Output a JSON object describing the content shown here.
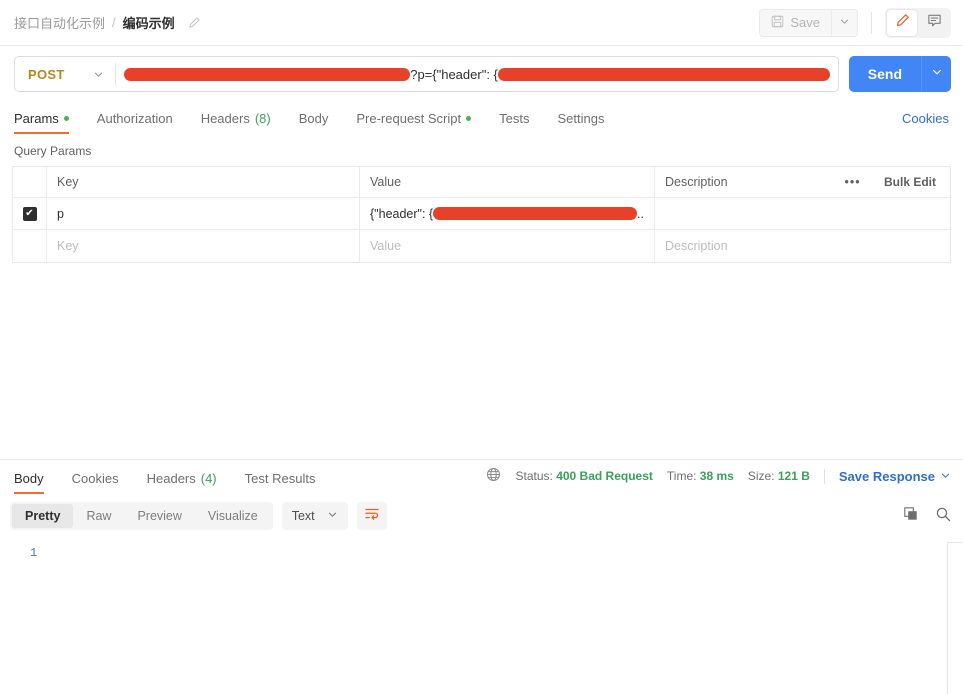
{
  "topbar": {
    "breadcrumb_collection": "接口自动化示例",
    "breadcrumb_separator": "/",
    "breadcrumb_current": "编码示例",
    "edit_icon": "pencil-icon",
    "save_label": "Save",
    "save_icon": "floppy-disk-icon",
    "save_caret_icon": "chevron-down-icon",
    "edit_toggle_icon": "pencil-icon",
    "comment_toggle_icon": "comment-icon",
    "accent_orange": "#ef5b25"
  },
  "url_row": {
    "method": "POST",
    "method_caret_icon": "chevron-down-icon",
    "method_color": "#b58a1b",
    "url_prefix_redacted_width": 326,
    "url_visible_text": "?p={\"header\": {",
    "url_suffix_redacted_width": 378,
    "redaction_color": "#e8412a",
    "send_label": "Send",
    "send_caret_icon": "chevron-down-icon",
    "send_color": "#4285f4"
  },
  "request_tabs": {
    "items": [
      {
        "label": "Params",
        "dot": true,
        "count": "",
        "active": true
      },
      {
        "label": "Authorization",
        "dot": false,
        "count": "",
        "active": false
      },
      {
        "label": "Headers",
        "dot": false,
        "count": "(8)",
        "active": false
      },
      {
        "label": "Body",
        "dot": false,
        "count": "",
        "active": false
      },
      {
        "label": "Pre-request Script",
        "dot": true,
        "count": "",
        "active": false
      },
      {
        "label": "Tests",
        "dot": false,
        "count": "",
        "active": false
      },
      {
        "label": "Settings",
        "dot": false,
        "count": "",
        "active": false
      }
    ],
    "cookies_label": "Cookies"
  },
  "query_params": {
    "title": "Query Params",
    "headers": {
      "key": "Key",
      "value": "Value",
      "description": "Description",
      "options_icon": "ellipsis-icon",
      "bulk_edit": "Bulk Edit"
    },
    "rows": [
      {
        "checked": true,
        "check_glyph": "✔",
        "key": "p",
        "value_prefix": "{\"header\": {",
        "value_redacted_width": 205,
        "value_suffix": "..",
        "description": ""
      }
    ],
    "empty_row": {
      "key_placeholder": "Key",
      "value_placeholder": "Value",
      "description_placeholder": "Description"
    }
  },
  "response": {
    "tabs": [
      {
        "label": "Body",
        "count": "",
        "active": true
      },
      {
        "label": "Cookies",
        "count": "",
        "active": false
      },
      {
        "label": "Headers",
        "count": "(4)",
        "active": false
      },
      {
        "label": "Test Results",
        "count": "",
        "active": false
      }
    ],
    "globe_icon": "globe-icon",
    "status_label": "Status:",
    "status_value": "400 Bad Request",
    "time_label": "Time:",
    "time_value": "38 ms",
    "size_label": "Size:",
    "size_value": "121 B",
    "save_response_label": "Save Response",
    "save_response_caret_icon": "chevron-down-icon",
    "view_modes": [
      {
        "label": "Pretty",
        "active": true
      },
      {
        "label": "Raw",
        "active": false
      },
      {
        "label": "Preview",
        "active": false
      },
      {
        "label": "Visualize",
        "active": false
      }
    ],
    "format_value": "Text",
    "format_caret_icon": "chevron-down-icon",
    "wrap_icon": "word-wrap-icon",
    "copy_icon": "copy-icon",
    "search_icon": "search-icon",
    "line_numbers": [
      "1"
    ],
    "body_text": ""
  }
}
